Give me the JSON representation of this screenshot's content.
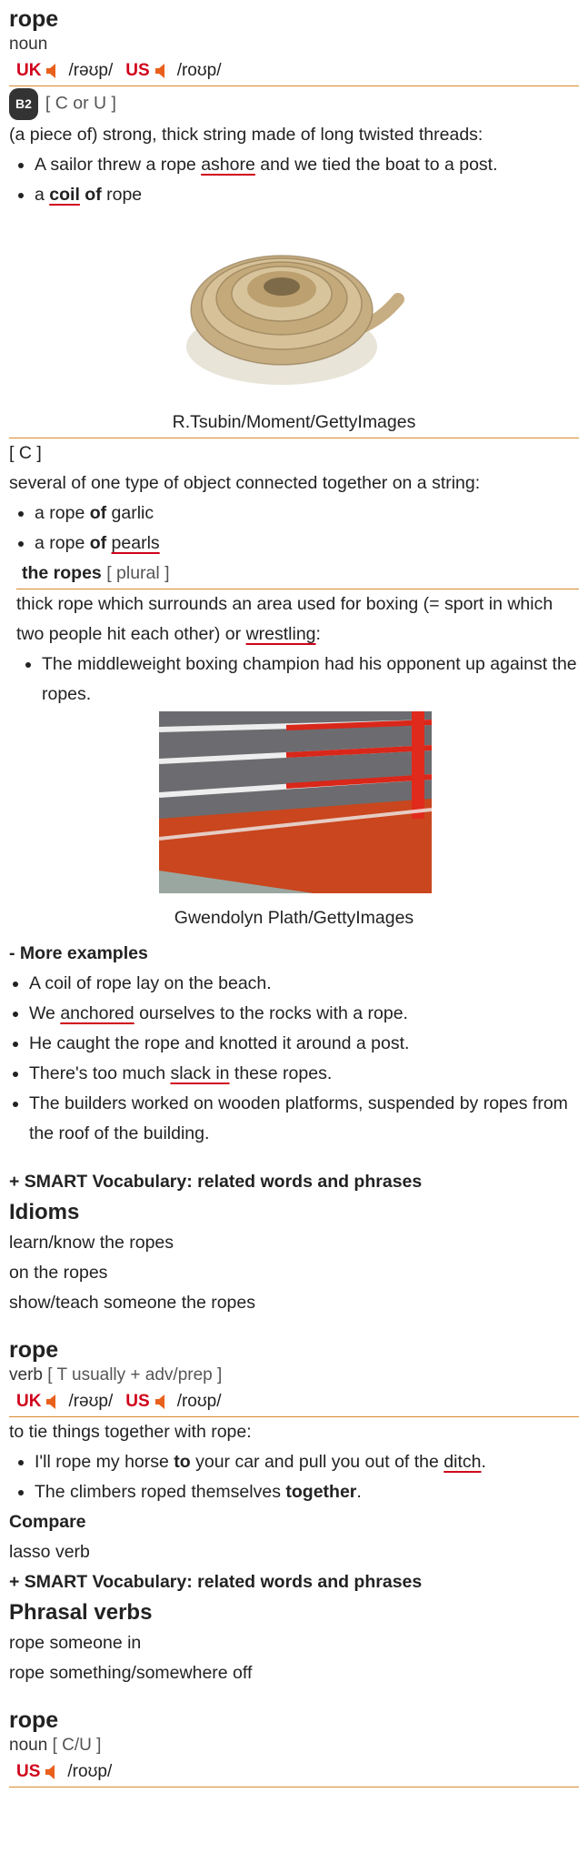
{
  "entry1": {
    "headword": "rope",
    "pos": "noun",
    "uk_label": "UK",
    "uk_ipa": "/rəʊp/",
    "us_label": "US",
    "us_ipa": "/roʊp/",
    "sense1": {
      "level": "B2",
      "grammar": "[ C or U ]",
      "definition": "(a piece of) strong, thick string made of long twisted threads:",
      "ex1_a": "A sailor threw a rope ",
      "ex1_b": "ashore",
      "ex1_c": " and we tied the boat to a post.",
      "ex2_a": "a ",
      "ex2_b": "coil",
      "ex2_c": " of",
      "ex2_d": " rope",
      "image_caption": "R.Tsubin/Moment/GettyImages"
    },
    "sense2": {
      "grammar": "[ C ]",
      "definition": "several of one type of object connected together on a string:",
      "ex1_a": "a rope ",
      "ex1_b": "of",
      "ex1_c": " garlic",
      "ex2_a": "a rope ",
      "ex2_b": "of",
      "ex2_c": " ",
      "ex2_d": "pearls"
    },
    "sense3": {
      "phrase": "the ropes",
      "grammar": "[ plural ]",
      "definition_a": "thick rope which surrounds an area used for boxing (= sport in which two people hit each other) or ",
      "definition_b": "wrestling",
      "definition_c": ":",
      "ex1": "The middleweight boxing champion had his opponent up against the ropes.",
      "image_caption": "Gwendolyn Plath/GettyImages"
    },
    "more_examples": {
      "title": "- More examples",
      "items": [
        "A coil of rope lay on the beach.",
        "We anchored ourselves to the rocks with a rope.",
        "He caught the rope and knotted it around a post.",
        "There's too much slack in these ropes.",
        "The builders worked on wooden platforms, suspended by ropes from the roof of the building."
      ],
      "ex2_a": "We ",
      "ex2_b": "anchored",
      "ex2_c": " ourselves to the rocks with a rope.",
      "ex4_a": "There's too much ",
      "ex4_b": "slack in",
      "ex4_c": " these ropes."
    },
    "smart_vocab": "+ SMART Vocabulary: related words and phrases",
    "idioms_title": "Idioms",
    "idioms": [
      "learn/know the ropes",
      "on the ropes",
      "show/teach someone the ropes"
    ]
  },
  "entry2": {
    "headword": "rope",
    "pos": "verb",
    "grammar": "[ T usually + adv/prep ]",
    "uk_label": "UK",
    "uk_ipa": "/rəʊp/",
    "us_label": "US",
    "us_ipa": "/roʊp/",
    "definition": "to tie things together with rope:",
    "ex1_a": "I'll rope my horse ",
    "ex1_b": "to",
    "ex1_c": " your car and pull you out of the ",
    "ex1_d": "ditch",
    "ex1_e": ".",
    "ex2_a": "The climbers roped themselves ",
    "ex2_b": "together",
    "ex2_c": ".",
    "compare_title": "Compare",
    "compare_item": "lasso verb",
    "smart_vocab": "+ SMART Vocabulary: related words and phrases",
    "phrasal_title": "Phrasal verbs",
    "phrasal": [
      "rope someone in",
      "rope something/somewhere off"
    ]
  },
  "entry3": {
    "headword": "rope",
    "pos": "noun",
    "grammar": "[ C/U ]",
    "us_label": "US",
    "us_ipa": "/roʊp/"
  },
  "colors": {
    "accent_rule": "#d88a2e",
    "region_red": "#d0021b",
    "speaker_orange": "#e8601c"
  }
}
